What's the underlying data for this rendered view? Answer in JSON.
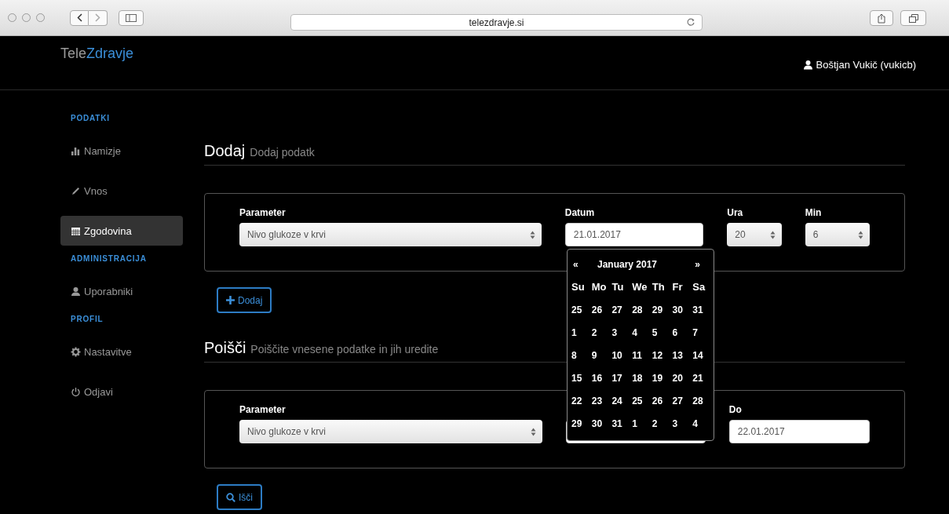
{
  "browser": {
    "url": "telezdravje.si"
  },
  "navbar": {
    "brand": [
      "Tele",
      "Zdravje"
    ],
    "user": "Boštjan Vukič (vukicb)"
  },
  "sidebar": {
    "sections": [
      {
        "heading": "PODATKI",
        "items": [
          {
            "label": "Namizje",
            "selected": false
          },
          {
            "label": "Vnos",
            "selected": false
          },
          {
            "label": "Zgodovina",
            "selected": true
          }
        ]
      },
      {
        "heading": "ADMINISTRACIJA",
        "items": [
          {
            "label": "Uporabniki",
            "selected": false
          }
        ]
      },
      {
        "heading": "PROFIL",
        "items": [
          {
            "label": "Nastavitve",
            "selected": false
          },
          {
            "label": "Odjavi",
            "selected": false
          }
        ]
      }
    ]
  },
  "add": {
    "title": "Dodaj",
    "subtitle": "Dodaj podatk",
    "fields": [
      {
        "kind": "select",
        "label": "Parameter",
        "value": "Nivo glukoze v krvi"
      },
      {
        "kind": "input",
        "label": "Datum",
        "value": "21.01.2017"
      },
      {
        "kind": "select",
        "label": "Ura",
        "value": "20"
      },
      {
        "kind": "select",
        "label": "Min",
        "value": "6"
      }
    ],
    "button": "Dodaj"
  },
  "search": {
    "title": "Poišči",
    "subtitle": "Poiščite vnesene podatke in jih uredite",
    "fields": [
      {
        "kind": "select",
        "label": "Parameter",
        "value": "Nivo glukoze v krvi"
      },
      {
        "kind": "hidden"
      },
      {
        "kind": "input",
        "label": "Do",
        "value": "22.01.2017"
      }
    ],
    "button": "Išči"
  },
  "datepicker": {
    "prev": "«",
    "title": "January 2017",
    "next": "»",
    "weekdays": [
      "Su",
      "Mo",
      "Tu",
      "We",
      "Th",
      "Fr",
      "Sa"
    ],
    "weeks": [
      [
        "25",
        "26",
        "27",
        "28",
        "29",
        "30",
        "31"
      ],
      [
        "1",
        "2",
        "3",
        "4",
        "5",
        "6",
        "7"
      ],
      [
        "8",
        "9",
        "10",
        "11",
        "12",
        "13",
        "14"
      ],
      [
        "15",
        "16",
        "17",
        "18",
        "19",
        "20",
        "21"
      ],
      [
        "22",
        "23",
        "24",
        "25",
        "26",
        "27",
        "28"
      ],
      [
        "29",
        "30",
        "31",
        "1",
        "2",
        "3",
        "4"
      ]
    ]
  }
}
